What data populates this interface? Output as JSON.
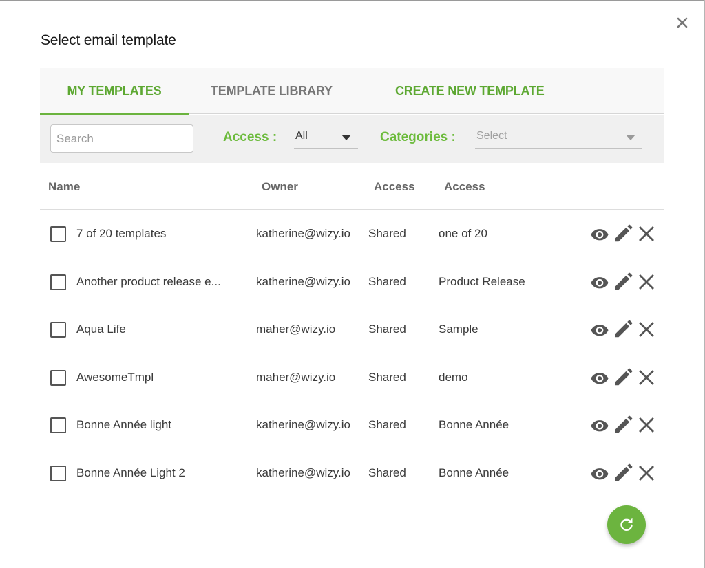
{
  "dialog": {
    "title": "Select email template",
    "close_icon": "close-icon"
  },
  "colors": {
    "accent": "#6cb43f",
    "accent_text": "#5da832",
    "muted_tab": "#777777"
  },
  "tabs": [
    {
      "label": "MY TEMPLATES",
      "active": true
    },
    {
      "label": "TEMPLATE LIBRARY",
      "active": false
    },
    {
      "label": "CREATE NEW TEMPLATE",
      "active": false
    }
  ],
  "filters": {
    "search_placeholder": "Search",
    "search_value": "",
    "access_label": "Access :",
    "access_value": "All",
    "categories_label": "Categories :",
    "categories_placeholder": "Select"
  },
  "table": {
    "columns": [
      "Name",
      "Owner",
      "Access",
      "Access"
    ],
    "rows": [
      {
        "name": "7 of 20 templates",
        "owner": "katherine@wizy.io",
        "access": "Shared",
        "category": "one of 20",
        "checked": false
      },
      {
        "name": "Another product release e...",
        "owner": "katherine@wizy.io",
        "access": "Shared",
        "category": "Product Release",
        "checked": false
      },
      {
        "name": "Aqua Life",
        "owner": "maher@wizy.io",
        "access": "Shared",
        "category": "Sample",
        "checked": false
      },
      {
        "name": "AwesomeTmpl",
        "owner": "maher@wizy.io",
        "access": "Shared",
        "category": "demo",
        "checked": false
      },
      {
        "name": "Bonne Année light",
        "owner": "katherine@wizy.io",
        "access": "Shared",
        "category": "Bonne Année",
        "checked": false
      },
      {
        "name": "Bonne Année Light 2",
        "owner": "katherine@wizy.io",
        "access": "Shared",
        "category": "Bonne Année",
        "checked": false
      }
    ],
    "row_actions": [
      "eye-icon",
      "pencil-icon",
      "delete-x-icon"
    ]
  },
  "fab": {
    "icon": "refresh-icon"
  }
}
